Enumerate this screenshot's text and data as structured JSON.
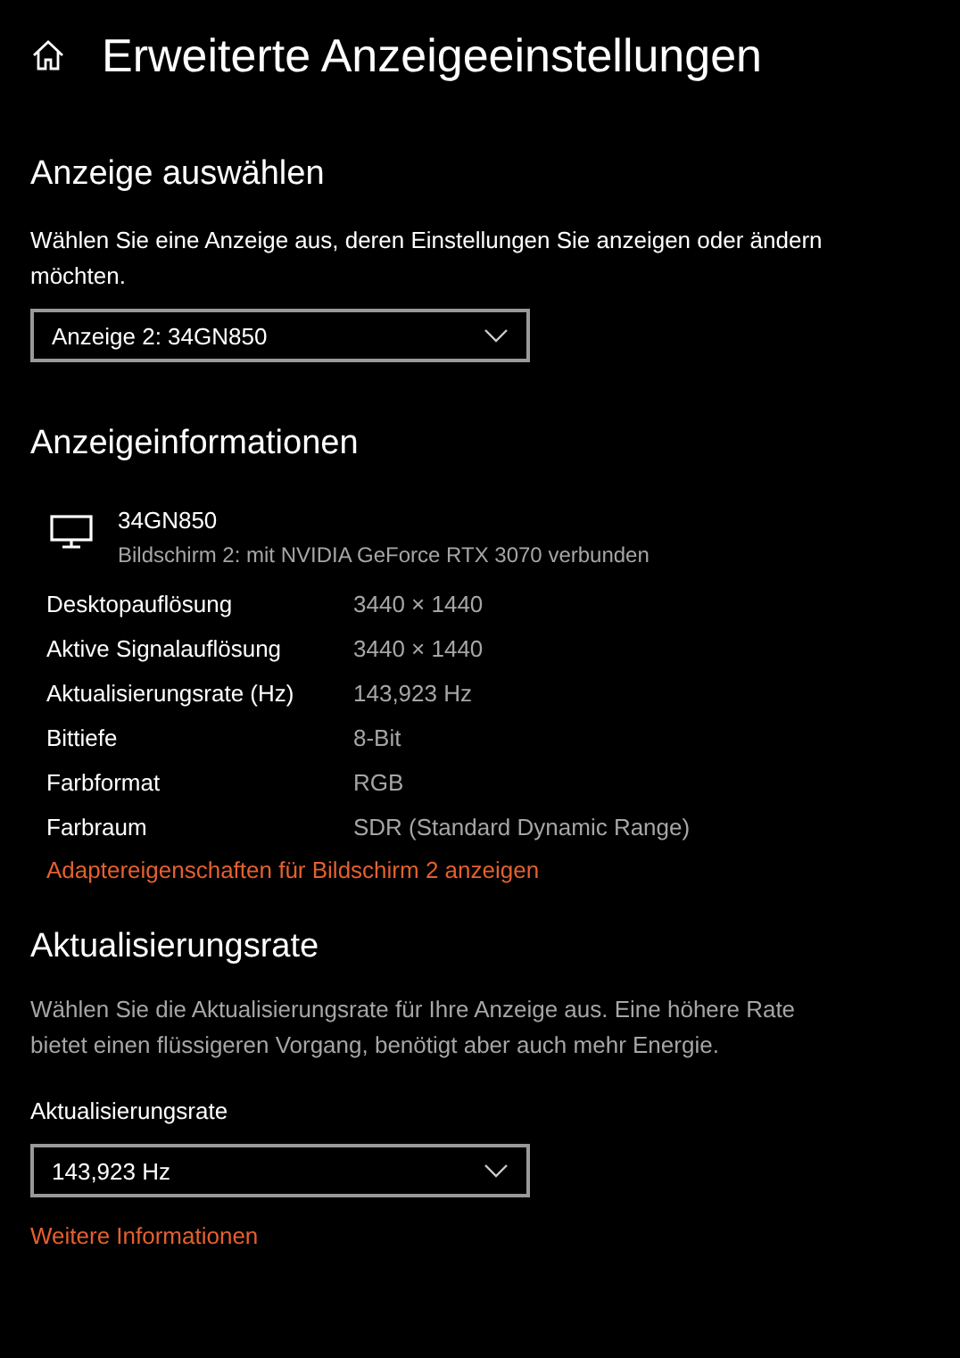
{
  "header": {
    "title": "Erweiterte Anzeigeeinstellungen"
  },
  "display_select": {
    "heading": "Anzeige auswählen",
    "description": "Wählen Sie eine Anzeige aus, deren Einstellungen Sie anzeigen oder ändern möchten.",
    "dropdown": {
      "value": "Anzeige 2: 34GN850"
    }
  },
  "display_info": {
    "heading": "Anzeigeinformationen",
    "monitor": {
      "name": "34GN850",
      "subtitle": "Bildschirm 2: mit NVIDIA GeForce RTX 3070 verbunden"
    },
    "rows": [
      {
        "label": "Desktopauflösung",
        "value": "3440 × 1440"
      },
      {
        "label": "Aktive Signalauflösung",
        "value": "3440 × 1440"
      },
      {
        "label": "Aktualisierungsrate (Hz)",
        "value": "143,923 Hz"
      },
      {
        "label": "Bittiefe",
        "value": "8-Bit"
      },
      {
        "label": "Farbformat",
        "value": "RGB"
      },
      {
        "label": "Farbraum",
        "value": "SDR (Standard Dynamic Range)"
      }
    ],
    "link": "Adaptereigenschaften für Bildschirm 2 anzeigen"
  },
  "refresh_rate": {
    "heading": "Aktualisierungsrate",
    "description": "Wählen Sie die Aktualisierungsrate für Ihre Anzeige aus. Eine höhere Rate bietet einen flüssigeren Vorgang, benötigt aber auch mehr Energie.",
    "field_label": "Aktualisierungsrate",
    "dropdown": {
      "value": "143,923 Hz"
    },
    "link": "Weitere Informationen"
  }
}
